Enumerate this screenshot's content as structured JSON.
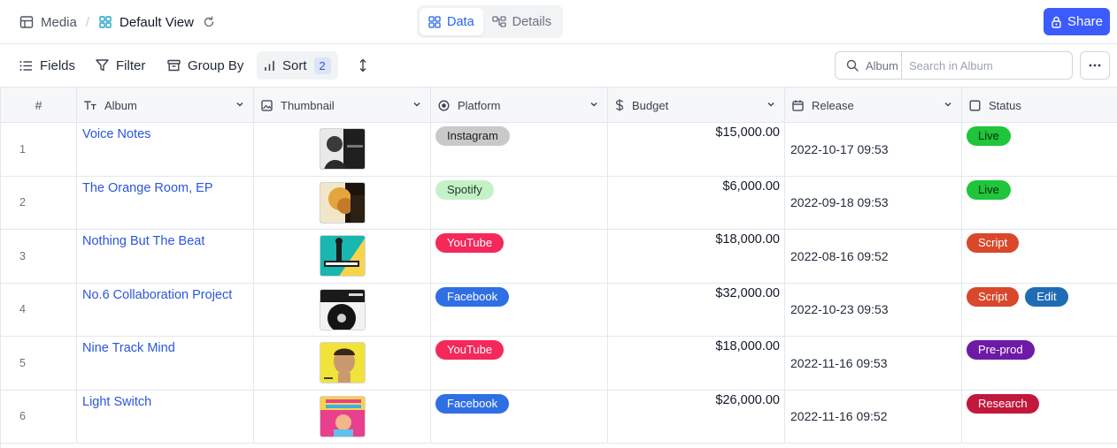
{
  "breadcrumb": {
    "parent": "Media",
    "separator": "/",
    "view": "Default View"
  },
  "view_tabs": [
    {
      "label": "Data",
      "active": true,
      "icon": "grid-icon"
    },
    {
      "label": "Details",
      "active": false,
      "icon": "details-icon"
    }
  ],
  "share_label": "Share",
  "toolbar": {
    "fields": "Fields",
    "filter": "Filter",
    "group_by": "Group By",
    "sort": "Sort",
    "sort_count": "2"
  },
  "search": {
    "scope": "Album",
    "placeholder": "Search in Album",
    "value": ""
  },
  "columns": {
    "num": "#",
    "album": "Album",
    "thumbnail": "Thumbnail",
    "platform": "Platform",
    "budget": "Budget",
    "release": "Release",
    "status": "Status"
  },
  "colors": {
    "accent": "#3b5bfd",
    "link": "#2b55e0",
    "platform": {
      "Instagram": {
        "bg": "#c9c9c9",
        "fg": "#1f1f1f"
      },
      "Spotify": {
        "bg": "#c5f1c8",
        "fg": "#1e3a22"
      },
      "YouTube": {
        "bg": "#f5285a",
        "fg": "#ffffff"
      },
      "Facebook": {
        "bg": "#2f6fe4",
        "fg": "#ffffff"
      }
    },
    "status": {
      "Live": {
        "bg": "#1fc53a",
        "fg": "#0b2a10"
      },
      "Script": {
        "bg": "#d9482b",
        "fg": "#ffffff"
      },
      "Edit": {
        "bg": "#1f6cb5",
        "fg": "#ffffff"
      },
      "Pre-prod": {
        "bg": "#6f1aa6",
        "fg": "#ffffff"
      },
      "Research": {
        "bg": "#c2183e",
        "fg": "#ffffff"
      }
    }
  },
  "rows": [
    {
      "num": "1",
      "album": "Voice Notes",
      "thumb": "thumbnail-voice-notes",
      "platform": "Instagram",
      "budget": "$15,000.00",
      "release": "2022-10-17 09:53",
      "status": [
        "Live"
      ]
    },
    {
      "num": "2",
      "album": "The Orange Room, EP",
      "thumb": "thumbnail-orange-room",
      "platform": "Spotify",
      "budget": "$6,000.00",
      "release": "2022-09-18 09:53",
      "status": [
        "Live"
      ]
    },
    {
      "num": "3",
      "album": "Nothing But The Beat",
      "thumb": "thumbnail-nothing-but-the-beat",
      "platform": "YouTube",
      "budget": "$18,000.00",
      "release": "2022-08-16 09:52",
      "status": [
        "Script"
      ]
    },
    {
      "num": "4",
      "album": "No.6 Collaboration Project",
      "thumb": "thumbnail-no6-collaboration",
      "platform": "Facebook",
      "budget": "$32,000.00",
      "release": "2022-10-23 09:53",
      "status": [
        "Script",
        "Edit"
      ]
    },
    {
      "num": "5",
      "album": "Nine Track Mind",
      "thumb": "thumbnail-nine-track-mind",
      "platform": "YouTube",
      "budget": "$18,000.00",
      "release": "2022-11-16 09:53",
      "status": [
        "Pre-prod"
      ]
    },
    {
      "num": "6",
      "album": "Light Switch",
      "thumb": "thumbnail-light-switch",
      "platform": "Facebook",
      "budget": "$26,000.00",
      "release": "2022-11-16 09:52",
      "status": [
        "Research"
      ]
    }
  ]
}
